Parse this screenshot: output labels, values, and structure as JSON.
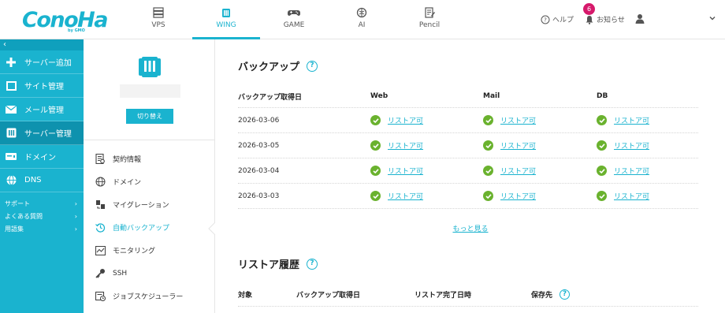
{
  "brand": {
    "logo_text": "ConoHa",
    "logo_sub": "by GMO"
  },
  "top_nav": [
    {
      "label": "VPS",
      "icon": "server-stack-icon"
    },
    {
      "label": "WING",
      "icon": "wing-server-icon",
      "active": true
    },
    {
      "label": "GAME",
      "icon": "gamepad-icon"
    },
    {
      "label": "AI",
      "icon": "ai-brain-icon"
    },
    {
      "label": "Pencil",
      "icon": "pencil-doc-icon"
    }
  ],
  "header": {
    "help_label": "ヘルプ",
    "notice_label": "お知らせ",
    "notice_count": "6"
  },
  "sidebar": {
    "collapse_glyph": "‹",
    "items": [
      {
        "label": "サーバー追加",
        "icon": "plus-icon"
      },
      {
        "label": "サイト管理",
        "icon": "window-icon"
      },
      {
        "label": "メール管理",
        "icon": "mail-icon"
      },
      {
        "label": "サーバー管理",
        "icon": "server-icon",
        "active": true
      },
      {
        "label": "ドメイン",
        "icon": "domain-icon"
      },
      {
        "label": "DNS",
        "icon": "globe-icon"
      }
    ],
    "support": [
      {
        "label": "サポート"
      },
      {
        "label": "よくある質問"
      },
      {
        "label": "用語集"
      }
    ]
  },
  "server_panel": {
    "switch_label": "切り替え",
    "menu": [
      {
        "label": "契約情報",
        "icon": "contract-icon"
      },
      {
        "label": "ドメイン",
        "icon": "globe-icon"
      },
      {
        "label": "マイグレーション",
        "icon": "migration-icon"
      },
      {
        "label": "自動バックアップ",
        "icon": "backup-clock-icon",
        "active": true
      },
      {
        "label": "モニタリング",
        "icon": "monitor-icon"
      },
      {
        "label": "SSH",
        "icon": "key-icon"
      },
      {
        "label": "ジョブスケジューラー",
        "icon": "scheduler-icon"
      }
    ]
  },
  "backup": {
    "title": "バックアップ",
    "columns": [
      "バックアップ取得日",
      "Web",
      "Mail",
      "DB"
    ],
    "rows": [
      {
        "date": "2026-03-06",
        "web": "リストア可",
        "mail": "リストア可",
        "db": "リストア可"
      },
      {
        "date": "2026-03-05",
        "web": "リストア可",
        "mail": "リストア可",
        "db": "リストア可"
      },
      {
        "date": "2026-03-04",
        "web": "リストア可",
        "mail": "リストア可",
        "db": "リストア可"
      },
      {
        "date": "2026-03-03",
        "web": "リストア可",
        "mail": "リストア可",
        "db": "リストア可"
      }
    ],
    "more_label": "もっと見る"
  },
  "restore_history": {
    "title": "リストア履歴",
    "columns": [
      "対象",
      "バックアップ取得日",
      "リストア完了日時",
      "保存先"
    ]
  },
  "colors": {
    "accent": "#1ab3cf",
    "ok_green": "#6ab22e",
    "badge": "#d6196b"
  }
}
